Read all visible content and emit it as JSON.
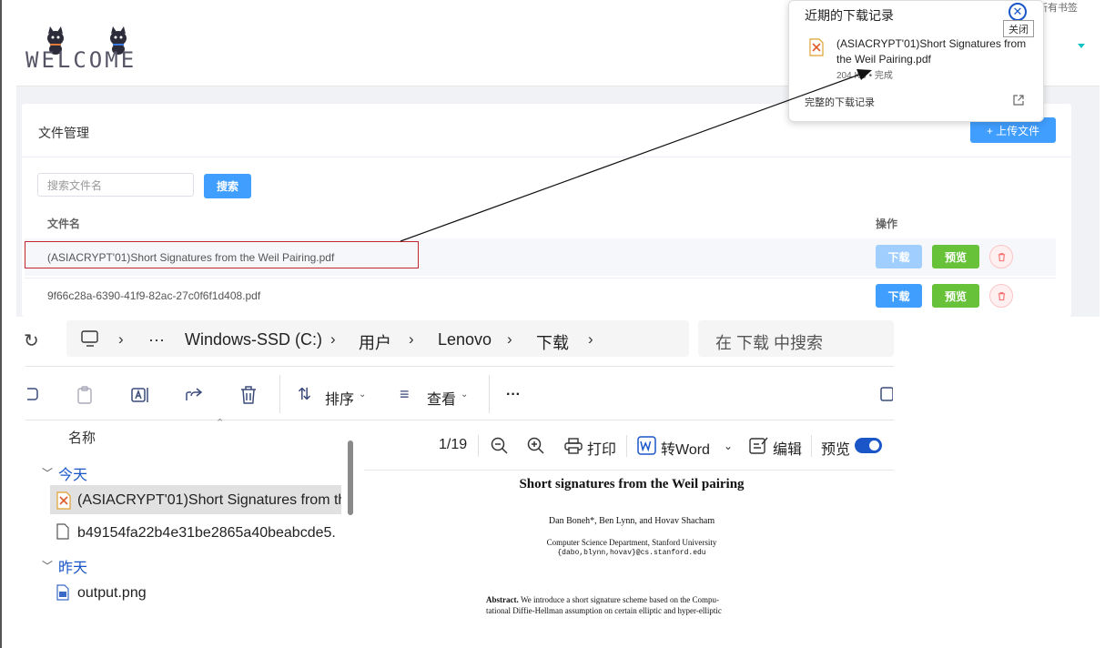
{
  "web": {
    "logo_text": "WELCOME",
    "bookmarks_label": "所有书签",
    "card_title": "文件管理",
    "upload_label": "+ 上传文件",
    "search_placeholder": "搜索文件名",
    "search_button": "搜索",
    "table": {
      "col_name": "文件名",
      "col_ops": "操作",
      "rows": [
        {
          "name": "(ASIACRYPT'01)Short Signatures from the Weil Pairing.pdf",
          "download": "下载",
          "preview": "预览"
        },
        {
          "name": "9f66c28a-6390-41f9-82ac-27c0f6f1d408.pdf",
          "download": "下载",
          "preview": "预览"
        }
      ]
    },
    "colors": {
      "primary": "#409eff",
      "success": "#67c23a",
      "danger": "#f56c6c",
      "highlight_box": "#c2272d"
    }
  },
  "downloads_popup": {
    "title": "近期的下载记录",
    "close_tooltip": "关闭",
    "file_name": "(ASIACRYPT'01)Short Signatures from the Weil Pairing.pdf",
    "file_meta": "204 KB • 完成",
    "full_history": "完整的下载记录"
  },
  "explorer": {
    "breadcrumb": [
      "Windows-SSD (C:)",
      "用户",
      "Lenovo",
      "下载"
    ],
    "ellipsis": "···",
    "search_placeholder": "在 下载 中搜索",
    "toolbar": {
      "sort": "排序",
      "view": "查看",
      "more": "···"
    },
    "column_name": "名称",
    "groups": [
      {
        "label": "今天",
        "items": [
          "(ASIACRYPT'01)Short Signatures from th",
          "b49154fa22b4e31be2865a40beabcde5."
        ]
      },
      {
        "label": "昨天",
        "items": [
          "output.png"
        ]
      }
    ],
    "preview": {
      "page": "1/19",
      "print": "打印",
      "to_word": "转Word",
      "edit": "编辑",
      "preview_label": "预览",
      "paper": {
        "title": "Short signatures from the Weil pairing",
        "authors": "Dan Boneh*, Ben Lynn, and Hovav Shacham",
        "dept": "Computer Science Department, Stanford University",
        "email": "{dabo,blynn,hovav}@cs.stanford.edu",
        "abstract_label": "Abstract.",
        "abstract_line1": "We introduce a short signature scheme based on the Compu-",
        "abstract_line2": "tational Diffie-Hellman assumption on certain elliptic and hyper-elliptic"
      }
    }
  }
}
